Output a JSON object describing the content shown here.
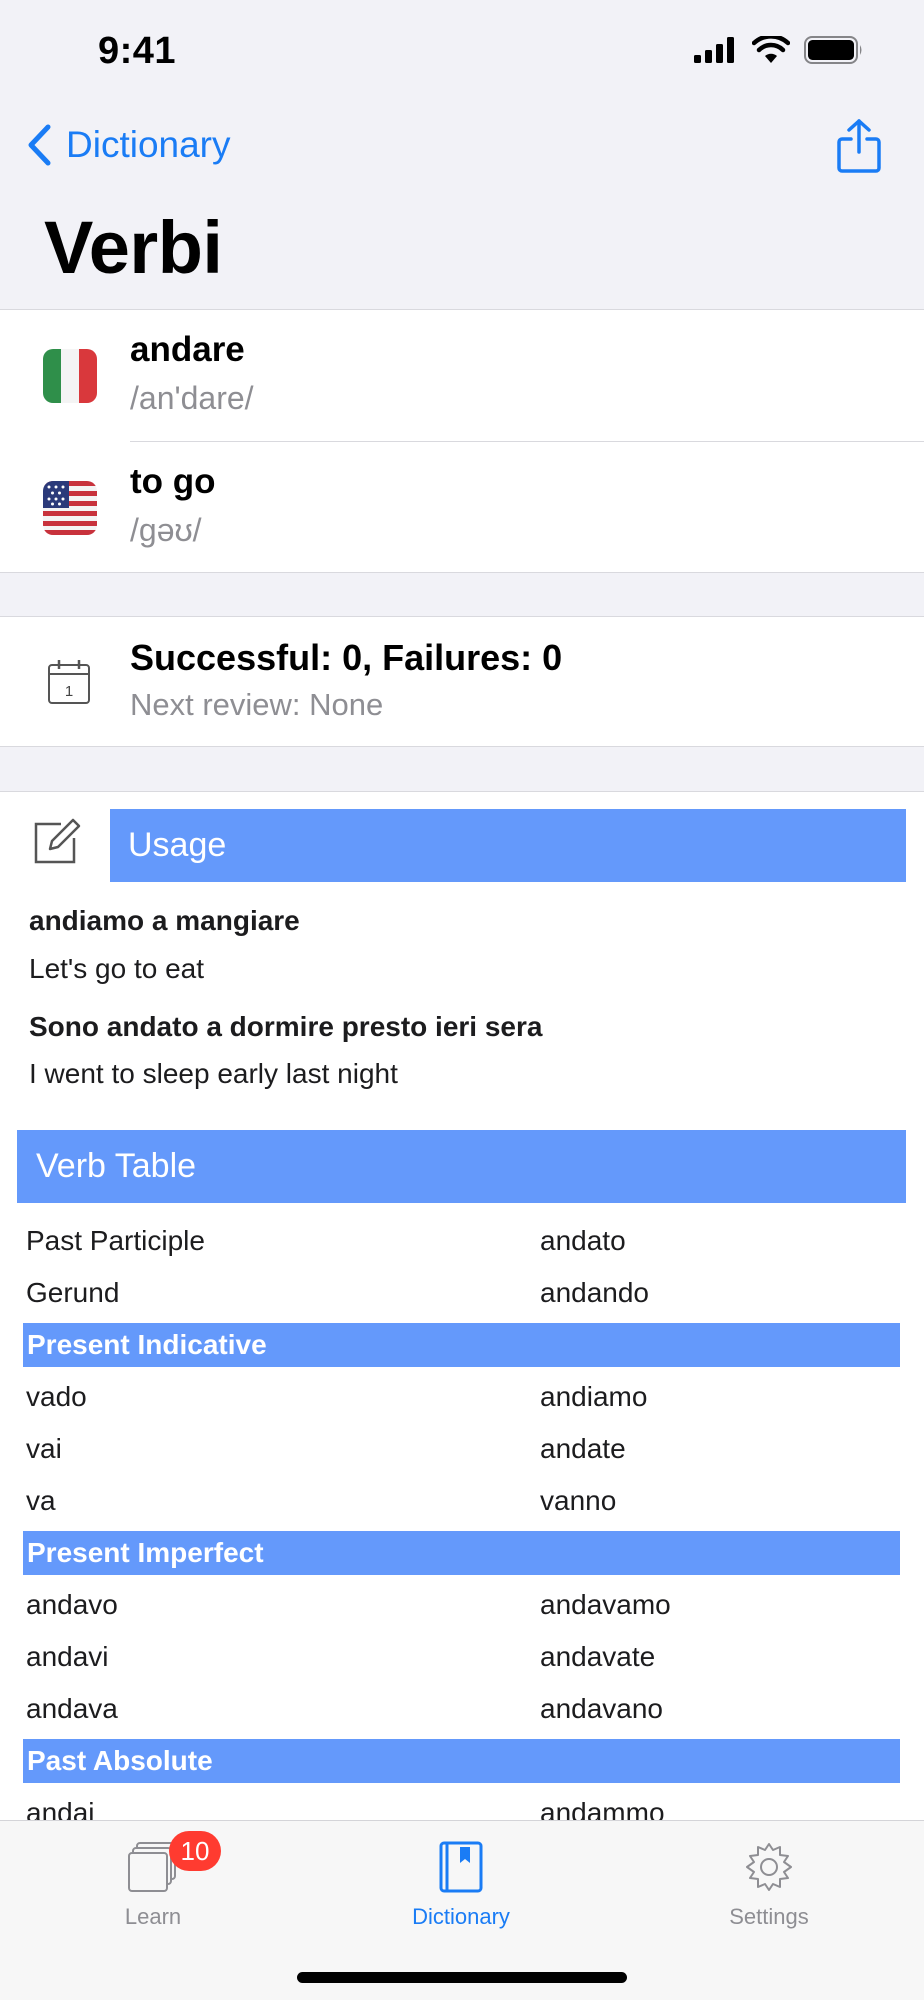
{
  "status_bar": {
    "time": "9:41"
  },
  "nav": {
    "back_label": "Dictionary",
    "title": "Verbi"
  },
  "words": [
    {
      "flag": "italy-flag-icon",
      "term": "andare",
      "pronunciation": "/an'dare/"
    },
    {
      "flag": "usa-flag-icon",
      "term": "to go",
      "pronunciation": "/gəʊ/"
    }
  ],
  "review": {
    "stats": "Successful: 0, Failures: 0",
    "next": "Next review: None",
    "calendar_day": "1"
  },
  "usage": {
    "header": "Usage",
    "examples": [
      {
        "phrase": "andiamo a mangiare",
        "translation": "Let's go to eat"
      },
      {
        "phrase": "Sono andato a dormire presto ieri sera",
        "translation": "I went to sleep early last night"
      }
    ]
  },
  "verb_table": {
    "header": "Verb Table",
    "forms": [
      {
        "label": "Past Participle",
        "value": "andato"
      },
      {
        "label": "Gerund",
        "value": "andando"
      }
    ],
    "tenses": [
      {
        "name": "Present Indicative",
        "rows": [
          [
            "vado",
            "andiamo"
          ],
          [
            "vai",
            "andate"
          ],
          [
            "va",
            "vanno"
          ]
        ]
      },
      {
        "name": "Present Imperfect",
        "rows": [
          [
            "andavo",
            "andavamo"
          ],
          [
            "andavi",
            "andavate"
          ],
          [
            "andava",
            "andavano"
          ]
        ]
      },
      {
        "name": "Past Absolute",
        "rows": [
          [
            "andai",
            "andammo"
          ]
        ]
      }
    ]
  },
  "tabbar": {
    "tabs": [
      {
        "label": "Learn",
        "icon": "cards-icon",
        "badge": "10",
        "active": false
      },
      {
        "label": "Dictionary",
        "icon": "book-icon",
        "active": true
      },
      {
        "label": "Settings",
        "icon": "gear-icon",
        "active": false
      }
    ]
  },
  "colors": {
    "accent": "#1a7cf5",
    "header_blue": "#6499fb",
    "badge_red": "#ff3b30",
    "inactive_gray": "#8e8e93"
  }
}
